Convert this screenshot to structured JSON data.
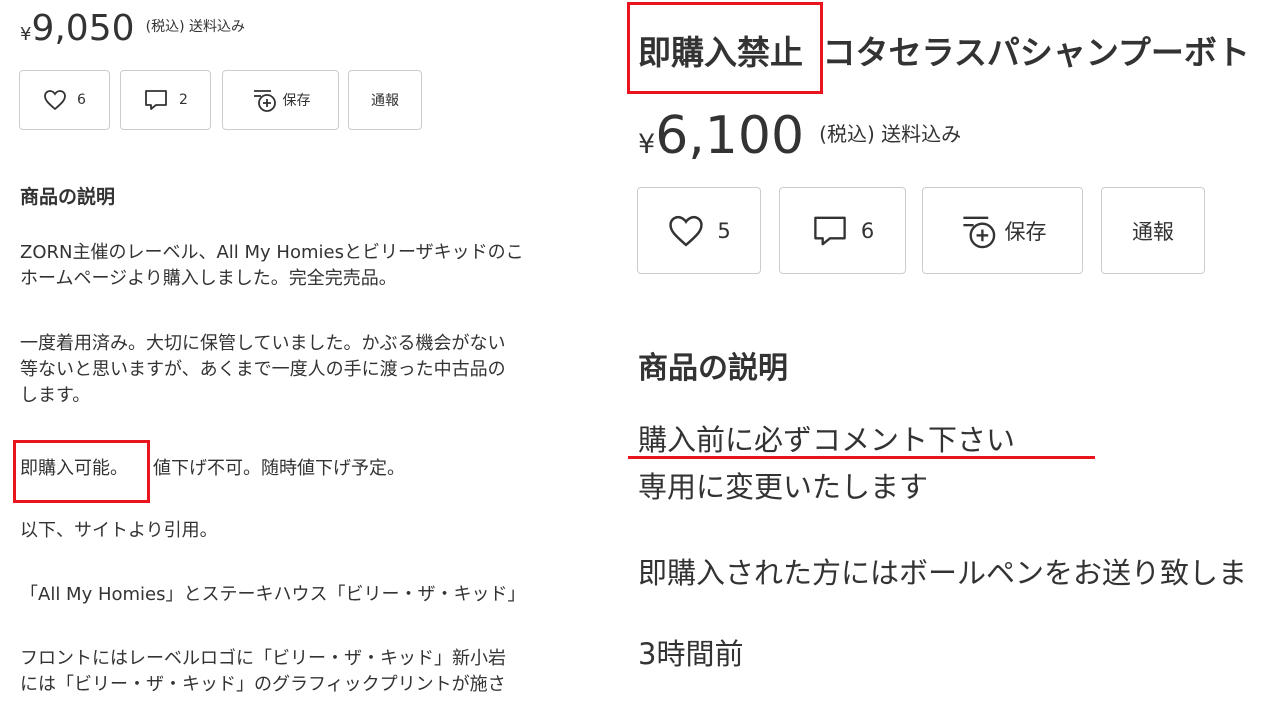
{
  "left": {
    "price": {
      "currency": "¥",
      "amount": "9,050",
      "tax_note": "(税込) 送料込み"
    },
    "buttons": {
      "like_count": "6",
      "comment_count": "2",
      "save_label": "保存",
      "report_label": "通報"
    },
    "description_heading": "商品の説明",
    "paragraphs": [
      "ZORN主催のレーベル、All My Homiesとビリーザキッドのこ",
      "ホームページより購入しました。完全完売品。",
      "一度着用済み。大切に保管していました。かぶる機会がない",
      "等ないと思いますが、あくまで一度人の手に渡った中古品の",
      "します。",
      "以下、サイトより引用。",
      "「All My Homies」とステーキハウス「ビリー・ザ・キッド」",
      "フロントにはレーベルロゴに「ビリー・ザ・キッド」新小岩",
      "には「ビリー・ザ・キッド」のグラフィックプリントが施さ"
    ],
    "highlight_text": "即購入可能。",
    "after_highlight_text": "値下げ不可。随時値下げ予定。"
  },
  "right": {
    "title_highlight": "即購入禁止",
    "title_rest": "コタセラスパシャンプーボト",
    "price": {
      "currency": "¥",
      "amount": "6,100",
      "tax_note": "(税込) 送料込み"
    },
    "buttons": {
      "like_count": "5",
      "comment_count": "6",
      "save_label": "保存",
      "report_label": "通報"
    },
    "description_heading": "商品の説明",
    "underlined_text": "購入前に必ずコメント下さい",
    "line2": "専用に変更いたします",
    "line3": "即購入された方にはボールペンをお送り致しま",
    "timestamp": "3時間前"
  },
  "colors": {
    "highlight": "#e8141e",
    "text": "#333333",
    "border": "#cccccc"
  }
}
